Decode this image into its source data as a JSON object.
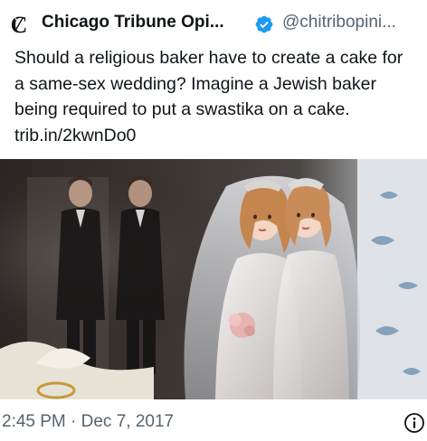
{
  "author": {
    "display_name": "Chicago Tribune Opi...",
    "handle": "@chitribopini...",
    "logo_letter": "C",
    "verified": true
  },
  "tweet": {
    "text": "Should a religious baker have to create a cake for a same-sex wedding? Imagine a Jewish baker being required to put a swastika on a cake.",
    "link": "trib.in/2kwnDo0"
  },
  "media": {
    "kind": "photo",
    "subject": "wedding-cake-toppers"
  },
  "footer": {
    "timestamp": "2:45 PM · Dec 7, 2017",
    "info_icon": "info-icon"
  },
  "colors": {
    "text": "#0f1419",
    "secondary": "#536471",
    "verified_blue": "#1d9bf0",
    "background": "#ffffff"
  }
}
